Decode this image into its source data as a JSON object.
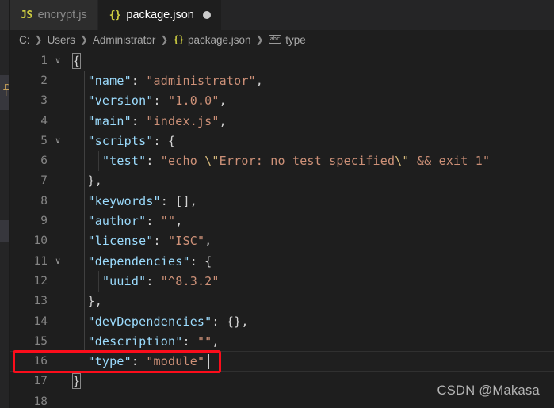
{
  "window": {
    "theme": "vscode-dark",
    "colors": {
      "editor_background": "#1e1e1e",
      "tabbar_background": "#252526",
      "inactive_tab_background": "#2d2d2d",
      "line_number": "#858585",
      "key_color": "#9cdcfe",
      "string_color": "#ce9178",
      "escape_color": "#d7ba7d",
      "punctuation_color": "#d4d4d4",
      "annotation_red": "#fc0d1b",
      "dirty_dot": "#cccccc"
    }
  },
  "tabs": [
    {
      "icon": "js-file-icon",
      "icon_glyph": "JS",
      "label": "encrypt.js",
      "active": false,
      "dirty": false
    },
    {
      "icon": "json-file-icon",
      "icon_glyph": "{}",
      "label": "package.json",
      "active": true,
      "dirty": true
    }
  ],
  "breadcrumb": {
    "separator": "❯",
    "items": [
      {
        "label": "C:",
        "icon": null
      },
      {
        "label": "Users",
        "icon": null
      },
      {
        "label": "Administrator",
        "icon": null
      },
      {
        "label": "package.json",
        "icon": "json-file-icon",
        "icon_glyph": "{}"
      },
      {
        "label": "type",
        "icon": "abc-symbol-icon",
        "icon_glyph": "abc"
      }
    ]
  },
  "editor": {
    "language": "json",
    "cursor_line": 16,
    "fold_chevron": "∨",
    "lines": [
      {
        "num": 1,
        "fold": true,
        "indent": 0,
        "current": false,
        "tokens": [
          {
            "t": "{",
            "c": "brace",
            "box": true
          }
        ]
      },
      {
        "num": 2,
        "fold": false,
        "indent": 1,
        "current": false,
        "tokens": [
          {
            "t": "\"name\"",
            "c": "key"
          },
          {
            "t": ": ",
            "c": "punct"
          },
          {
            "t": "\"administrator\"",
            "c": "str"
          },
          {
            "t": ",",
            "c": "punct"
          }
        ]
      },
      {
        "num": 3,
        "fold": false,
        "indent": 1,
        "current": false,
        "tokens": [
          {
            "t": "\"version\"",
            "c": "key"
          },
          {
            "t": ": ",
            "c": "punct"
          },
          {
            "t": "\"1.0.0\"",
            "c": "str"
          },
          {
            "t": ",",
            "c": "punct"
          }
        ]
      },
      {
        "num": 4,
        "fold": false,
        "indent": 1,
        "current": false,
        "tokens": [
          {
            "t": "\"main\"",
            "c": "key"
          },
          {
            "t": ": ",
            "c": "punct"
          },
          {
            "t": "\"index.js\"",
            "c": "str"
          },
          {
            "t": ",",
            "c": "punct"
          }
        ]
      },
      {
        "num": 5,
        "fold": true,
        "indent": 1,
        "current": false,
        "tokens": [
          {
            "t": "\"scripts\"",
            "c": "key"
          },
          {
            "t": ": {",
            "c": "punct"
          }
        ]
      },
      {
        "num": 6,
        "fold": false,
        "indent": 2,
        "current": false,
        "tokens": [
          {
            "t": "\"test\"",
            "c": "key"
          },
          {
            "t": ": ",
            "c": "punct"
          },
          {
            "t": "\"echo ",
            "c": "str"
          },
          {
            "t": "\\\"",
            "c": "esc"
          },
          {
            "t": "Error: no test specified",
            "c": "str"
          },
          {
            "t": "\\\"",
            "c": "esc"
          },
          {
            "t": " && exit 1\"",
            "c": "str"
          }
        ]
      },
      {
        "num": 7,
        "fold": false,
        "indent": 1,
        "current": false,
        "tokens": [
          {
            "t": "},",
            "c": "punct"
          }
        ]
      },
      {
        "num": 8,
        "fold": false,
        "indent": 1,
        "current": false,
        "tokens": [
          {
            "t": "\"keywords\"",
            "c": "key"
          },
          {
            "t": ": [],",
            "c": "punct"
          }
        ]
      },
      {
        "num": 9,
        "fold": false,
        "indent": 1,
        "current": false,
        "tokens": [
          {
            "t": "\"author\"",
            "c": "key"
          },
          {
            "t": ": ",
            "c": "punct"
          },
          {
            "t": "\"\"",
            "c": "str"
          },
          {
            "t": ",",
            "c": "punct"
          }
        ]
      },
      {
        "num": 10,
        "fold": false,
        "indent": 1,
        "current": false,
        "tokens": [
          {
            "t": "\"license\"",
            "c": "key"
          },
          {
            "t": ": ",
            "c": "punct"
          },
          {
            "t": "\"ISC\"",
            "c": "str"
          },
          {
            "t": ",",
            "c": "punct"
          }
        ]
      },
      {
        "num": 11,
        "fold": true,
        "indent": 1,
        "current": false,
        "tokens": [
          {
            "t": "\"dependencies\"",
            "c": "key"
          },
          {
            "t": ": {",
            "c": "punct"
          }
        ]
      },
      {
        "num": 12,
        "fold": false,
        "indent": 2,
        "current": false,
        "tokens": [
          {
            "t": "\"uuid\"",
            "c": "key"
          },
          {
            "t": ": ",
            "c": "punct"
          },
          {
            "t": "\"^8.3.2\"",
            "c": "str"
          }
        ]
      },
      {
        "num": 13,
        "fold": false,
        "indent": 1,
        "current": false,
        "tokens": [
          {
            "t": "},",
            "c": "punct"
          }
        ]
      },
      {
        "num": 14,
        "fold": false,
        "indent": 1,
        "current": false,
        "tokens": [
          {
            "t": "\"devDependencies\"",
            "c": "key"
          },
          {
            "t": ": {},",
            "c": "punct"
          }
        ]
      },
      {
        "num": 15,
        "fold": false,
        "indent": 1,
        "current": false,
        "tokens": [
          {
            "t": "\"description\"",
            "c": "key"
          },
          {
            "t": ": ",
            "c": "punct"
          },
          {
            "t": "\"\"",
            "c": "str"
          },
          {
            "t": ",",
            "c": "punct"
          }
        ]
      },
      {
        "num": 16,
        "fold": false,
        "indent": 1,
        "current": true,
        "caret_after": true,
        "tokens": [
          {
            "t": "\"type\"",
            "c": "key"
          },
          {
            "t": ": ",
            "c": "punct"
          },
          {
            "t": "\"module\"",
            "c": "str"
          }
        ]
      },
      {
        "num": 17,
        "fold": false,
        "indent": 0,
        "current": false,
        "tokens": [
          {
            "t": "}",
            "c": "brace",
            "box": true
          }
        ]
      },
      {
        "num": 18,
        "fold": false,
        "indent": 0,
        "current": false,
        "tokens": []
      }
    ]
  },
  "annotation": {
    "name": "red-highlight-rectangle",
    "target_line": 16,
    "target_text": "\"type\": \"module\"",
    "color": "#fc0d1b"
  },
  "watermark": {
    "text": "CSDN @Makasa"
  }
}
